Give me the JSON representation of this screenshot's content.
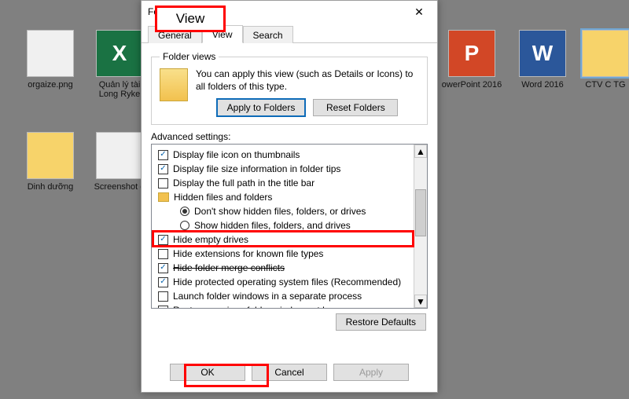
{
  "desktop": {
    "items": [
      {
        "name": "orgaize.png",
        "kind": "paper"
      },
      {
        "name": "Quản lý tài Long Ryke",
        "kind": "excel",
        "glyph": "X"
      },
      {
        "name": "owerPoint 2016",
        "kind": "ppt",
        "glyph": "P"
      },
      {
        "name": "Word 2016",
        "kind": "word",
        "glyph": "W"
      },
      {
        "name": "CTV C TG",
        "kind": "sel"
      },
      {
        "name": "Dinh dưỡng",
        "kind": "fold"
      },
      {
        "name": "Screenshot g",
        "kind": "paper"
      }
    ]
  },
  "dialog": {
    "title": "Folder Options",
    "close_glyph": "✕",
    "tabs": [
      {
        "id": "general",
        "label": "General"
      },
      {
        "id": "view",
        "label": "View"
      },
      {
        "id": "search",
        "label": "Search"
      }
    ],
    "active_tab": "view"
  },
  "folder_views": {
    "legend": "Folder views",
    "text": "You can apply this view (such as Details or Icons) to all folders of this type.",
    "apply_btn": "Apply to Folders",
    "reset_btn": "Reset Folders"
  },
  "advanced": {
    "label": "Advanced settings:",
    "items": [
      {
        "type": "cb",
        "check": true,
        "indent": 0,
        "text": "Display file icon on thumbnails"
      },
      {
        "type": "cb",
        "check": true,
        "indent": 0,
        "text": "Display file size information in folder tips"
      },
      {
        "type": "cb",
        "check": false,
        "indent": 0,
        "text": "Display the full path in the title bar"
      },
      {
        "type": "fold",
        "indent": 0,
        "text": "Hidden files and folders"
      },
      {
        "type": "rb",
        "check": true,
        "indent": 2,
        "text": "Don't show hidden files, folders, or drives"
      },
      {
        "type": "rb",
        "check": false,
        "indent": 2,
        "text": "Show hidden files, folders, and drives"
      },
      {
        "type": "cb",
        "check": true,
        "indent": 0,
        "text": "Hide empty drives"
      },
      {
        "type": "cb",
        "check": false,
        "indent": 0,
        "text": "Hide extensions for known file types"
      },
      {
        "type": "cb",
        "check": true,
        "indent": 0,
        "strike": true,
        "text": "Hide folder merge conflicts"
      },
      {
        "type": "cb",
        "check": true,
        "indent": 0,
        "text": "Hide protected operating system files (Recommended)"
      },
      {
        "type": "cb",
        "check": false,
        "indent": 0,
        "text": "Launch folder windows in a separate process"
      },
      {
        "type": "cb",
        "check": false,
        "indent": 0,
        "text": "Restore previous folder windows at logon"
      }
    ],
    "restore_btn": "Restore Defaults"
  },
  "footer": {
    "ok": "OK",
    "cancel": "Cancel",
    "apply": "Apply"
  },
  "annotations": {
    "view_label": "View"
  }
}
